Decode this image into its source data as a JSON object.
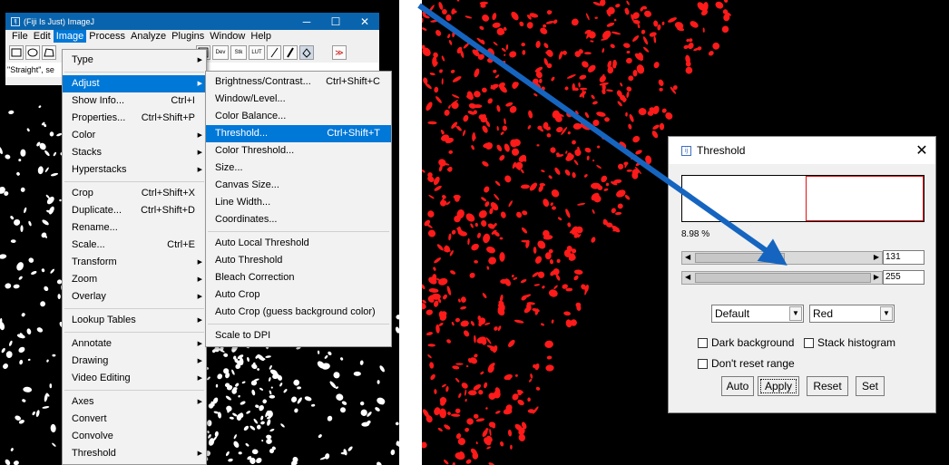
{
  "fiji": {
    "title": "(Fiji Is Just) ImageJ",
    "controls": {
      "minimize": "─",
      "maximize": "☐",
      "close": "✕"
    },
    "menubar": [
      "File",
      "Edit",
      "Image",
      "Process",
      "Analyze",
      "Plugins",
      "Window",
      "Help"
    ],
    "toolbar": {
      "dev": "Dev",
      "stk": "Stk",
      "lut": "LUT",
      "more": "≫"
    },
    "status": "\"Straight\", se"
  },
  "image_menu": {
    "items": [
      {
        "label": "Type",
        "shortcut": "",
        "submenu": true
      },
      {
        "separator": true
      },
      {
        "label": "Adjust",
        "shortcut": "",
        "submenu": true,
        "highlighted": true
      },
      {
        "label": "Show Info...",
        "shortcut": "Ctrl+I"
      },
      {
        "label": "Properties...",
        "shortcut": "Ctrl+Shift+P"
      },
      {
        "label": "Color",
        "shortcut": "",
        "submenu": true
      },
      {
        "label": "Stacks",
        "shortcut": "",
        "submenu": true
      },
      {
        "label": "Hyperstacks",
        "shortcut": "",
        "submenu": true
      },
      {
        "separator": true
      },
      {
        "label": "Crop",
        "shortcut": "Ctrl+Shift+X"
      },
      {
        "label": "Duplicate...",
        "shortcut": "Ctrl+Shift+D"
      },
      {
        "label": "Rename...",
        "shortcut": ""
      },
      {
        "label": "Scale...",
        "shortcut": "Ctrl+E"
      },
      {
        "label": "Transform",
        "shortcut": "",
        "submenu": true
      },
      {
        "label": "Zoom",
        "shortcut": "",
        "submenu": true
      },
      {
        "label": "Overlay",
        "shortcut": "",
        "submenu": true
      },
      {
        "separator": true
      },
      {
        "label": "Lookup Tables",
        "shortcut": "",
        "submenu": true
      },
      {
        "separator": true
      },
      {
        "label": "Annotate",
        "shortcut": "",
        "submenu": true
      },
      {
        "label": "Drawing",
        "shortcut": "",
        "submenu": true
      },
      {
        "label": "Video Editing",
        "shortcut": "",
        "submenu": true
      },
      {
        "separator": true
      },
      {
        "label": "Axes",
        "shortcut": "",
        "submenu": true
      },
      {
        "label": "Convert",
        "shortcut": ""
      },
      {
        "label": "Convolve",
        "shortcut": ""
      },
      {
        "label": "Threshold",
        "shortcut": "",
        "submenu": true
      }
    ]
  },
  "adjust_menu": {
    "items": [
      {
        "label": "Brightness/Contrast...",
        "shortcut": "Ctrl+Shift+C"
      },
      {
        "label": "Window/Level..."
      },
      {
        "label": "Color Balance..."
      },
      {
        "label": "Threshold...",
        "shortcut": "Ctrl+Shift+T",
        "highlighted": true
      },
      {
        "label": "Color Threshold..."
      },
      {
        "label": "Size..."
      },
      {
        "label": "Canvas Size..."
      },
      {
        "label": "Line Width..."
      },
      {
        "label": "Coordinates..."
      },
      {
        "separator": true
      },
      {
        "label": "Auto Local Threshold"
      },
      {
        "label": "Auto Threshold"
      },
      {
        "label": "Bleach Correction"
      },
      {
        "label": "Auto Crop"
      },
      {
        "label": "Auto Crop (guess background color)"
      },
      {
        "separator": true
      },
      {
        "label": "Scale to DPI"
      }
    ]
  },
  "threshold": {
    "title": "Threshold",
    "close": "✕",
    "percent": "8.98 %",
    "lower_value": "131",
    "upper_value": "255",
    "lower_fraction": 0.51,
    "upper_fraction": 1.0,
    "method": "Default",
    "display": "Red",
    "checkboxes": {
      "dark_background": "Dark background",
      "stack_histogram": "Stack histogram",
      "dont_reset": "Don't reset range"
    },
    "buttons": {
      "auto": "Auto",
      "apply": "Apply",
      "reset": "Reset",
      "set": "Set"
    }
  },
  "colors": {
    "titlebar_blue": "#0a64ad",
    "menu_highlight": "#0078d7",
    "threshold_red": "#ff0000",
    "arrow": "#1565c0"
  }
}
